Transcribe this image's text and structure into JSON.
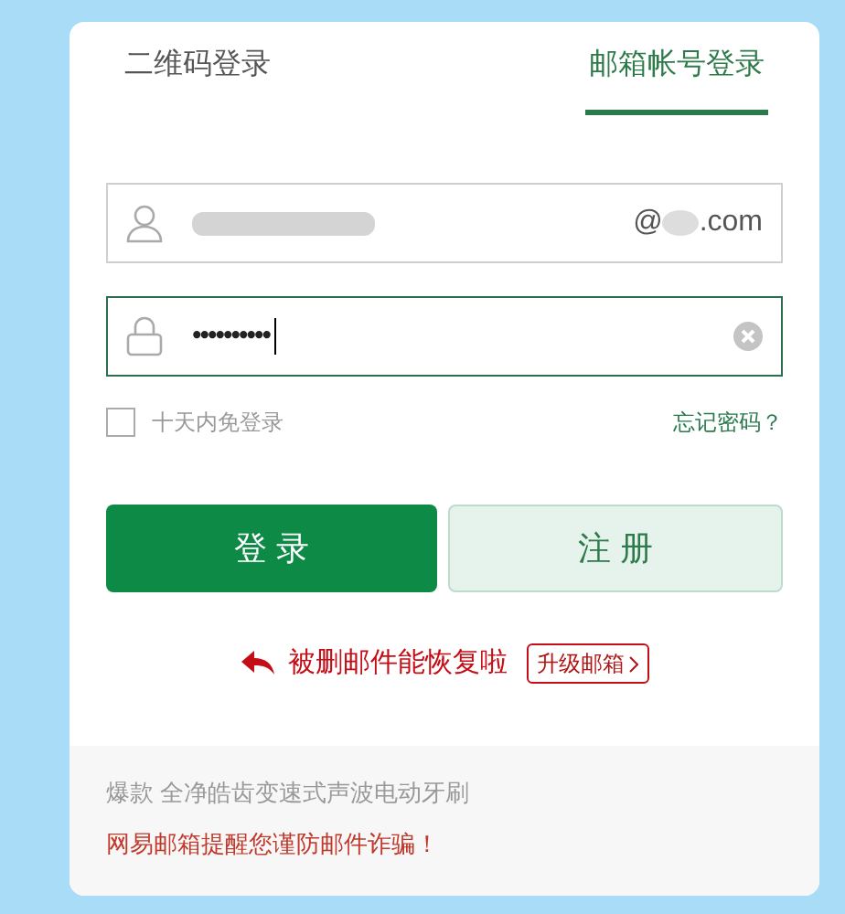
{
  "tabs": [
    {
      "label": "二维码登录",
      "selected": false
    },
    {
      "label": "邮箱帐号登录",
      "selected": true
    }
  ],
  "account_field": {
    "domain_prefix": "@",
    "domain_suffix": ".com"
  },
  "password_field": {
    "value": "••••••••••",
    "focused": true
  },
  "remember": {
    "label": "十天内免登录",
    "checked": false
  },
  "forgot_link": "忘记密码？",
  "buttons": [
    {
      "label": "登 录",
      "kind": "primary"
    },
    {
      "label": "注 册",
      "kind": "secondary"
    }
  ],
  "promo": {
    "text": "被删邮件能恢复啦",
    "button": "升级邮箱"
  },
  "footer": [
    {
      "text": "爆款 全净皓齿变速式声波电动牙刷",
      "kind": "ad"
    },
    {
      "text": "网易邮箱提醒您谨防邮件诈骗！",
      "kind": "warning"
    }
  ]
}
